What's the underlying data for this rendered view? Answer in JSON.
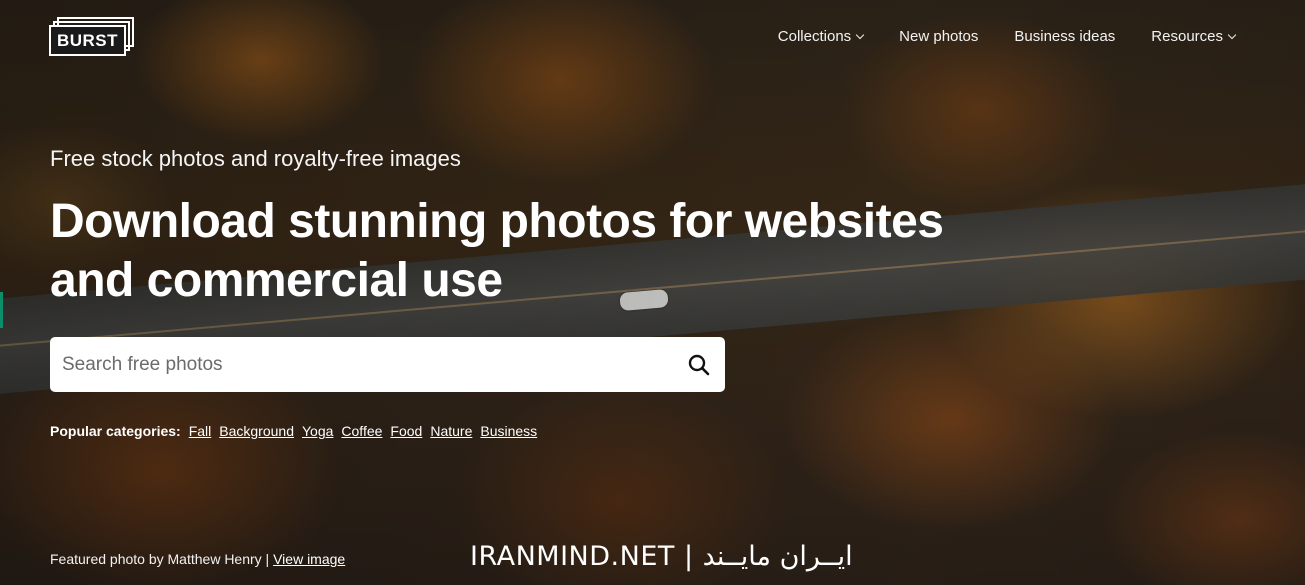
{
  "header": {
    "logo_text": "BURST",
    "nav": [
      {
        "label": "Collections",
        "has_dropdown": true
      },
      {
        "label": "New photos",
        "has_dropdown": false
      },
      {
        "label": "Business ideas",
        "has_dropdown": false
      },
      {
        "label": "Resources",
        "has_dropdown": true
      }
    ]
  },
  "hero": {
    "tagline": "Free stock photos and royalty-free images",
    "headline": "Download stunning photos for websites and commercial use",
    "search": {
      "placeholder": "Search free photos",
      "value": "",
      "icon": "search-icon"
    },
    "popular": {
      "label": "Popular categories:",
      "items": [
        "Fall",
        "Background",
        "Yoga",
        "Coffee",
        "Food",
        "Nature",
        "Business"
      ]
    }
  },
  "footer": {
    "credit_text": "Featured photo by Matthew Henry |",
    "credit_link": "View image"
  },
  "watermark": "IRANMIND.NET | ایــران مایــند",
  "colors": {
    "accent": "#0a8f6a",
    "text": "#ffffff",
    "search_bg": "#ffffff"
  }
}
